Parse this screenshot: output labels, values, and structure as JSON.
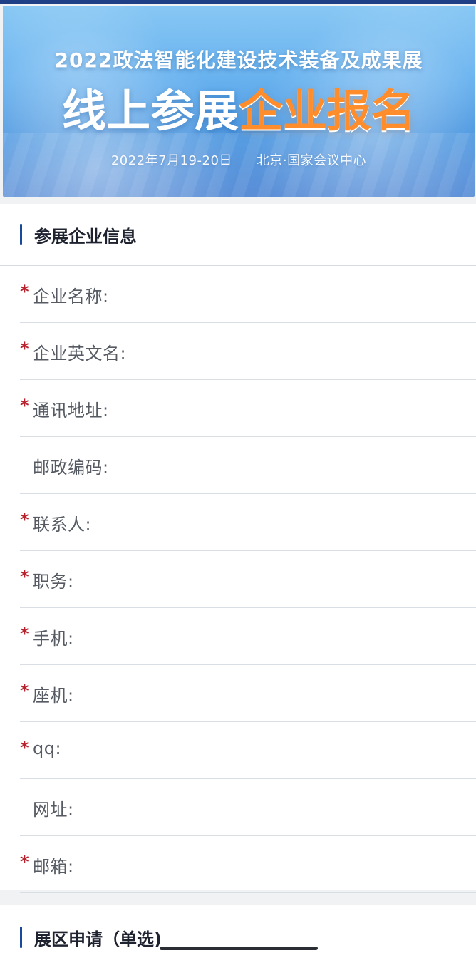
{
  "banner": {
    "title": "2022政法智能化建设技术装备及成果展",
    "headline_part1": "线上参展",
    "headline_part2": "企业报名",
    "date": "2022年7月19-20日",
    "location": "北京·国家会议中心"
  },
  "section1": {
    "title": "参展企业信息",
    "fields": [
      {
        "label": "企业名称:",
        "required": true
      },
      {
        "label": "企业英文名:",
        "required": true
      },
      {
        "label": "通讯地址:",
        "required": true
      },
      {
        "label": "邮政编码:",
        "required": false
      },
      {
        "label": "联系人:",
        "required": true
      },
      {
        "label": "职务:",
        "required": true
      },
      {
        "label": "手机:",
        "required": true
      },
      {
        "label": "座机:",
        "required": true
      },
      {
        "label": "qq:",
        "required": true
      },
      {
        "label": "网址:",
        "required": false
      },
      {
        "label": "邮箱:",
        "required": true
      }
    ]
  },
  "section2": {
    "title": "展区申请（单选)"
  }
}
